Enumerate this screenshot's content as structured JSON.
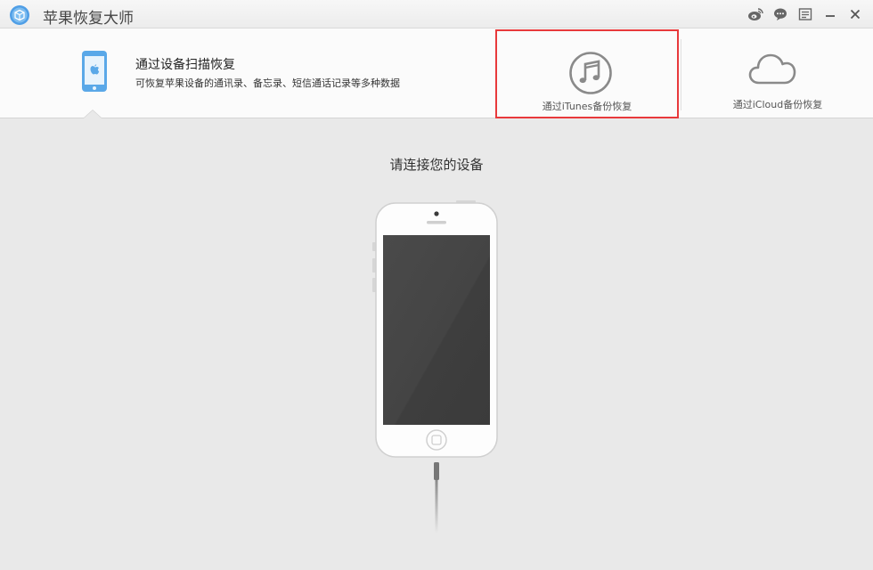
{
  "window": {
    "title": "苹果恢复大师"
  },
  "modes": {
    "scan": {
      "title": "通过设备扫描恢复",
      "description": "可恢复苹果设备的通讯录、备忘录、短信通话记录等多种数据"
    },
    "itunes": {
      "label": "通过iTunes备份恢复"
    },
    "icloud": {
      "label": "通过iCloud备份恢复"
    }
  },
  "main": {
    "prompt": "请连接您的设备"
  },
  "colors": {
    "accent_blue": "#5aa8e8",
    "highlight_red": "#e8393b",
    "icon_gray": "#8a8a8a"
  },
  "icons": [
    "app-logo-icon",
    "weibo-icon",
    "chat-icon",
    "menu-icon",
    "minimize-icon",
    "close-icon",
    "phone-icon",
    "music-note-icon",
    "cloud-icon"
  ]
}
